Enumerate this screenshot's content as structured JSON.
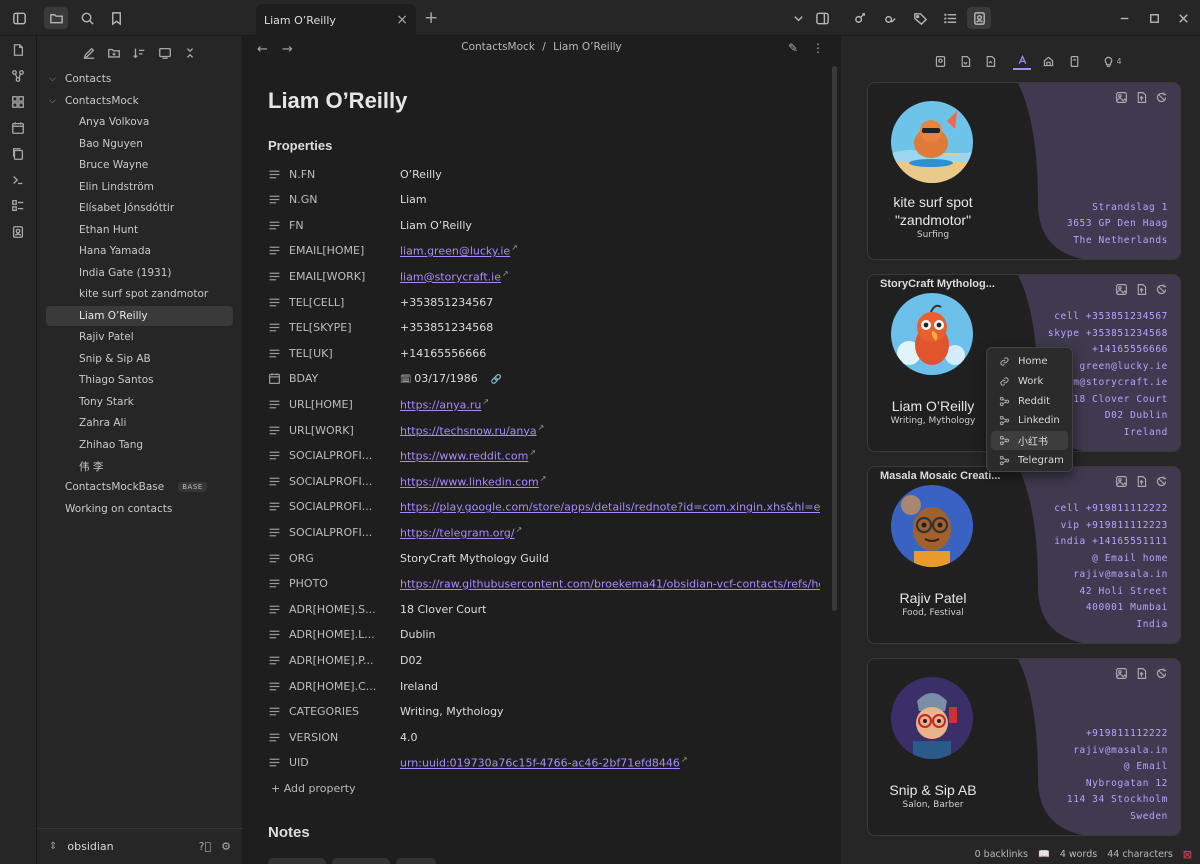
{
  "tab": {
    "title": "Liam O’Reilly"
  },
  "breadcrumb": {
    "vault": "ContactsMock",
    "sep": "/",
    "note": "Liam O’Reilly"
  },
  "sidebar": {
    "folders": [
      {
        "label": "Contacts",
        "expanded": false
      },
      {
        "label": "ContactsMock",
        "expanded": true
      }
    ],
    "files": [
      "Anya Volkova",
      "Bao Nguyen",
      "Bruce Wayne",
      "Elin Lindström",
      "Elísabet Jónsdóttir",
      "Ethan Hunt",
      "Hana Yamada",
      "India Gate (1931)",
      "kite surf spot zandmotor",
      "Liam O’Reilly",
      "Rajiv Patel",
      "Snip & Sip AB",
      "Thiago Santos",
      "Tony Stark",
      "Zahra Ali",
      "Zhihao Tang",
      "伟 李"
    ],
    "active_file": "Liam O’Reilly",
    "root_items": [
      {
        "label": "ContactsMockBase",
        "badge": "BASE"
      },
      {
        "label": "Working on contacts"
      }
    ],
    "vault_name": "obsidian"
  },
  "note": {
    "title": "Liam O’Reilly",
    "properties_heading": "Properties",
    "properties": [
      {
        "key": "N.FN",
        "value": "O’Reilly",
        "icon": "text-icon"
      },
      {
        "key": "N.GN",
        "value": "Liam",
        "icon": "text-icon"
      },
      {
        "key": "FN",
        "value": "Liam O’Reilly",
        "icon": "text-icon"
      },
      {
        "key": "EMAIL[HOME]",
        "value": "liam.green@lucky.ie",
        "icon": "text-icon",
        "link": true
      },
      {
        "key": "EMAIL[WORK]",
        "value": "liam@storycraft.ie",
        "icon": "text-icon",
        "link": true
      },
      {
        "key": "TEL[CELL]",
        "value": "+353851234567",
        "icon": "text-icon"
      },
      {
        "key": "TEL[SKYPE]",
        "value": "+353851234568",
        "icon": "text-icon"
      },
      {
        "key": "TEL[UK]",
        "value": "+14165556666",
        "icon": "text-icon"
      },
      {
        "key": "BDAY",
        "value": "03/17/1986",
        "icon": "calendar-icon",
        "date": true
      },
      {
        "key": "URL[HOME]",
        "value": "https://anya.ru",
        "icon": "text-icon",
        "link": true
      },
      {
        "key": "URL[WORK]",
        "value": "https://techsnow.ru/anya",
        "icon": "text-icon",
        "link": true
      },
      {
        "key": "SOCIALPROFI...",
        "value": "https://www.reddit.com",
        "icon": "text-icon",
        "link": true
      },
      {
        "key": "SOCIALPROFI...",
        "value": "https://www.linkedin.com",
        "icon": "text-icon",
        "link": true
      },
      {
        "key": "SOCIALPROFI...",
        "value": "https://play.google.com/store/apps/details/rednote?id=com.xingin.xhs&hl=en_ZA",
        "icon": "text-icon",
        "link": true
      },
      {
        "key": "SOCIALPROFI...",
        "value": "https://telegram.org/",
        "icon": "text-icon",
        "link": true
      },
      {
        "key": "ORG",
        "value": "StoryCraft Mythology Guild",
        "icon": "text-icon"
      },
      {
        "key": "PHOTO",
        "value": "https://raw.githubusercontent.com/broekema41/obsidian-vcf-contacts/refs/heads/",
        "icon": "text-icon",
        "link": true
      },
      {
        "key": "ADR[HOME].S...",
        "value": "18 Clover Court",
        "icon": "text-icon"
      },
      {
        "key": "ADR[HOME].L...",
        "value": "Dublin",
        "icon": "text-icon"
      },
      {
        "key": "ADR[HOME].P...",
        "value": "D02",
        "icon": "text-icon"
      },
      {
        "key": "ADR[HOME].C...",
        "value": "Ireland",
        "icon": "text-icon"
      },
      {
        "key": "CATEGORIES",
        "value": "Writing, Mythology",
        "icon": "text-icon"
      },
      {
        "key": "VERSION",
        "value": "4.0",
        "icon": "text-icon"
      },
      {
        "key": "UID",
        "value": "urn:uuid:019730a76c15f-4766-ac46-2bf71efd8446",
        "icon": "text-icon",
        "link": true
      }
    ],
    "add_property": "+ Add property",
    "notes_heading": "Notes"
  },
  "right_panel": {
    "lightbulb_count": "4",
    "cards": [
      {
        "title": "",
        "name_lines": [
          "kite surf spot",
          "\"zandmotor\""
        ],
        "subtitle": "Surfing",
        "info": [
          "Strandslag 1",
          "3653 GP Den Haag",
          "The Netherlands"
        ],
        "avatar": "capybara-surfer"
      },
      {
        "title": "StoryCraft Mytholog...",
        "name_lines": [
          "Liam O’Reilly"
        ],
        "subtitle": "Writing, Mythology",
        "info": [
          "cell +353851234567",
          "skype +353851234568",
          "+14165556666",
          "green@lucky.ie",
          "m@storycraft.ie",
          "18 Clover Court",
          "D02 Dublin",
          "Ireland"
        ],
        "avatar": "parrot"
      },
      {
        "title": "Masala Mosaic Creati...",
        "name_lines": [
          "Rajiv Patel"
        ],
        "subtitle": "Food, Festival",
        "info": [
          "cell +919811112222",
          "vip +919811112223",
          "india +14165551111",
          "@ Email home",
          "rajiv@masala.in",
          "42 Holi Street",
          "400001 Mumbai",
          "India"
        ],
        "avatar": "glasses-man"
      },
      {
        "title": "",
        "name_lines": [
          "Snip & Sip AB"
        ],
        "subtitle": "Salon, Barber",
        "info": [
          "+919811112222",
          "rajiv@masala.in",
          "@ Email",
          "Nybrogatan 12",
          "114 34 Stockholm",
          "Sweden"
        ],
        "avatar": "barber"
      }
    ],
    "context_menu": [
      "Home",
      "Work",
      "Reddit",
      "Linkedin",
      "小红书",
      "Telegram"
    ],
    "context_menu_hover": "小红书"
  },
  "status": {
    "backlinks": "0 backlinks",
    "words": "4 words",
    "characters": "44 characters"
  },
  "colors": {
    "accent": "#a88bfa",
    "card_shape": "#3f3a4f",
    "info_text": "#b9a4ff"
  }
}
